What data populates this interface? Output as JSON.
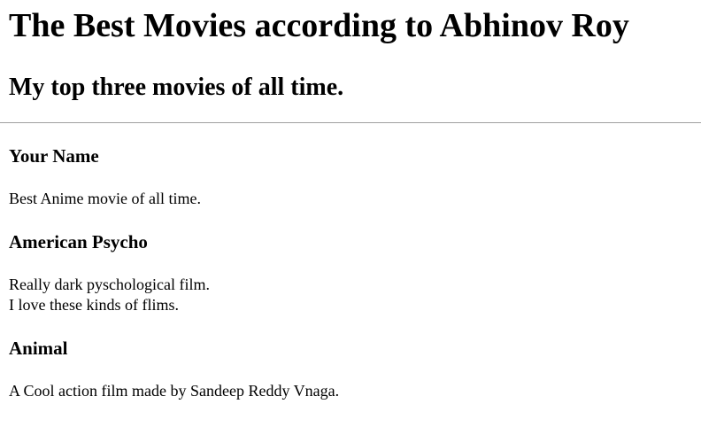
{
  "page": {
    "title": "The Best Movies according to Abhinov Roy",
    "subtitle": "My top three movies of all time."
  },
  "movies": [
    {
      "title": "Your Name",
      "description_lines": [
        "Best Anime movie of all time."
      ]
    },
    {
      "title": "American Psycho",
      "description_lines": [
        "Really dark pyschological film.",
        "I love these kinds of flims."
      ]
    },
    {
      "title": "Animal",
      "description_lines": [
        "A Cool action film made by Sandeep Reddy Vnaga."
      ]
    }
  ]
}
